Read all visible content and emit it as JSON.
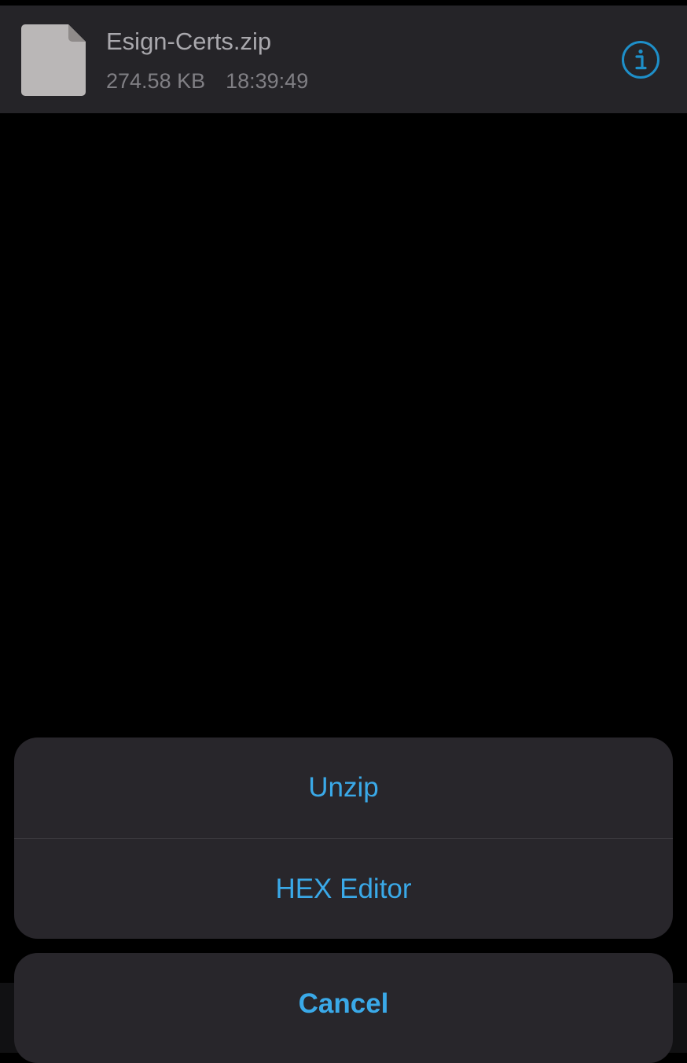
{
  "file": {
    "name": "Esign-Certs.zip",
    "size": "274.58 KB",
    "time": "18:39:49",
    "icon": "document-icon",
    "info_icon": "info-icon"
  },
  "action_sheet": {
    "actions": [
      {
        "label": "Unzip"
      },
      {
        "label": "HEX Editor"
      }
    ],
    "cancel_label": "Cancel"
  },
  "colors": {
    "accent": "#3aa9e8",
    "sheet_background": "#28262b",
    "row_background": "#252428"
  }
}
